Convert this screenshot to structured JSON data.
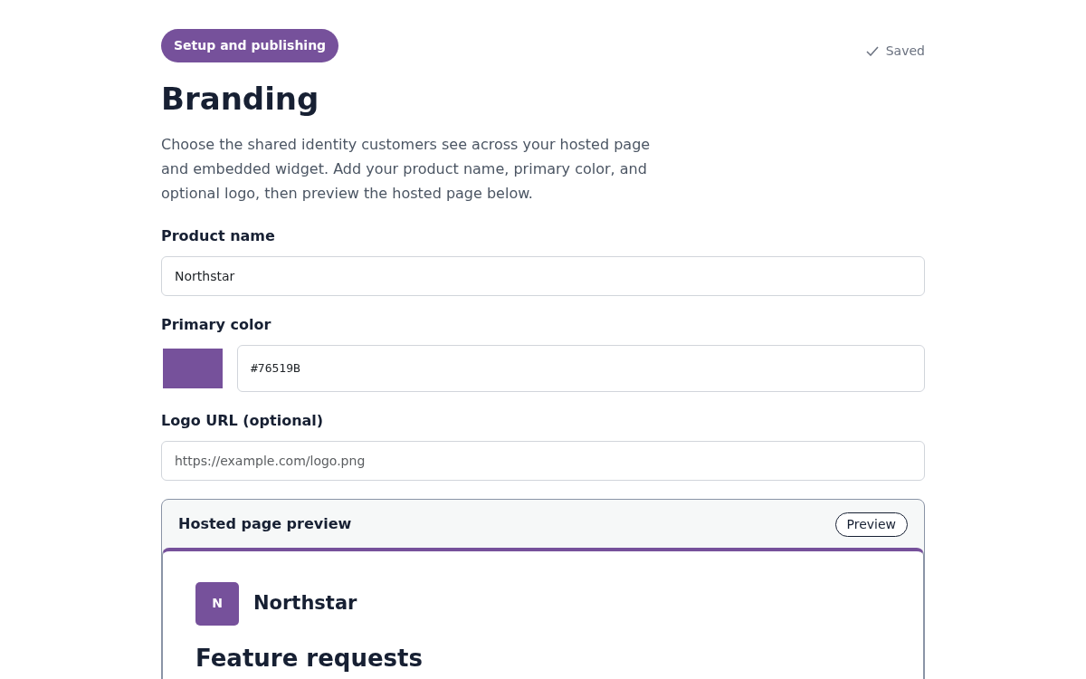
{
  "section_badge": "Setup and publishing",
  "save_status": {
    "label": "Saved",
    "saved": true
  },
  "title": "Branding",
  "description": "Choose the shared identity customers see across your hosted page and embedded widget. Add your product name, primary color, and optional logo, then preview the hosted page below.",
  "fields": [
    {
      "kind": "text",
      "label": "Product name",
      "value": "Northstar"
    },
    {
      "kind": "color",
      "label": "Primary color",
      "value": "#76519B",
      "color": "#76519b"
    },
    {
      "kind": "text",
      "label": "Logo URL (optional)",
      "placeholder": "https://example.com/logo.png"
    }
  ],
  "preview": {
    "title": "Hosted page preview",
    "button": "Preview",
    "logo_letter": "N",
    "product_name": "Northstar",
    "heading": "Feature requests"
  }
}
